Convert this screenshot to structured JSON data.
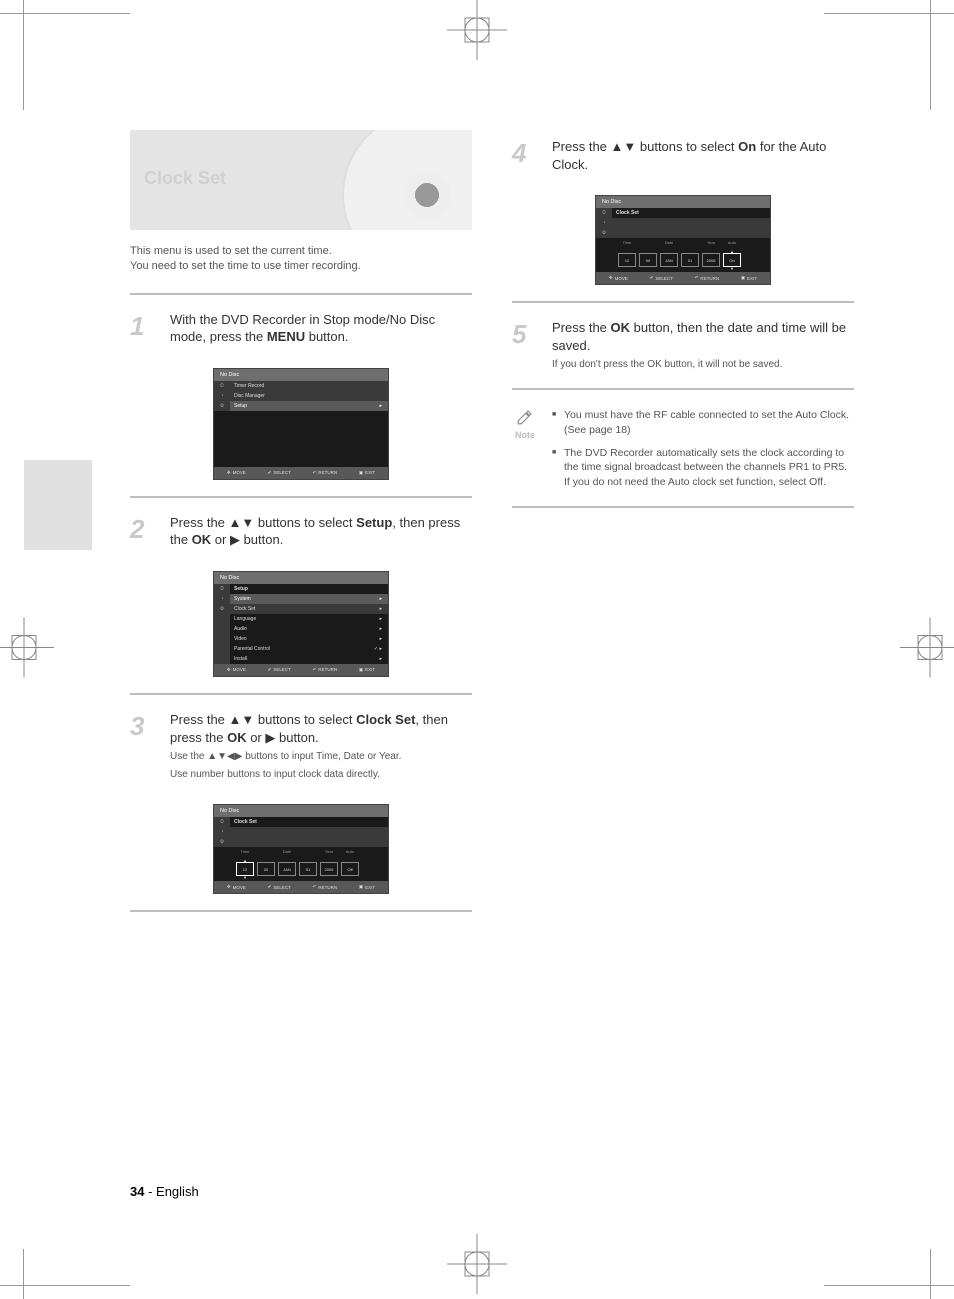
{
  "page": {
    "number": "34",
    "lang_label": "- English"
  },
  "header": {
    "title": "Clock Set"
  },
  "intro": {
    "line1": "This menu is used to set the current time.",
    "line2": "You need to set the time to use timer recording."
  },
  "steps": {
    "s1": {
      "num": "1",
      "pre": "With the DVD Recorder in Stop mode/No Disc mode, press the ",
      "bold": "MENU",
      "post": " button."
    },
    "s2": {
      "num": "2",
      "pre": "Press the ▲▼ buttons to select ",
      "bold": "Setup",
      "mid": ", then press the ",
      "bold2": "OK",
      "post": " or ▶ button."
    },
    "s3": {
      "num": "3",
      "pre": "Press the ▲▼ buttons to select ",
      "bold": "Clock Set",
      "mid": ", then press the ",
      "bold2": "OK",
      "post": " or ▶ button.",
      "sub1": "Use the ▲▼◀▶ buttons to input Time, Date or Year.",
      "sub2": "Use number buttons to input clock data directly."
    },
    "s4": {
      "num": "4",
      "pre": "Press the ▲▼ buttons to select ",
      "bold": "On",
      "post": " for the Auto Clock."
    },
    "s5": {
      "num": "5",
      "pre": "Press the ",
      "bold": "OK",
      "post": " button, then the date and time will be saved.",
      "sub": "If you don't press the OK button, it will not be saved."
    }
  },
  "notes": {
    "label": "Note",
    "item1": "You must have the RF cable connected to set the Auto Clock. (See page 18)",
    "item2": "The DVD Recorder automatically sets the clock according to the time signal broadcast between the channels PR1 to PR5. If you do not need the Auto clock set function, select Off."
  },
  "screens": {
    "common_footer": {
      "move": "MOVE",
      "select": "SELECT",
      "return": "RETURN",
      "exit": "EXIT"
    },
    "screen1": {
      "title": "No Disc",
      "items": [
        "Timer Record",
        "Disc Manager",
        "Setup"
      ],
      "hl_index": 2
    },
    "screen2": {
      "title": "No Disc",
      "heading": "Setup",
      "items": [
        {
          "label": "System",
          "val": ""
        },
        {
          "label": "Clock Set",
          "val": ""
        },
        {
          "label": "Language",
          "val": ""
        },
        {
          "label": "Audio",
          "val": ""
        },
        {
          "label": "Video",
          "val": ""
        },
        {
          "label": "Parental Control",
          "val": ""
        },
        {
          "label": "Install",
          "val": ""
        }
      ],
      "hl_index": 1
    },
    "screen3": {
      "title": "No Disc",
      "heading": "Clock Set",
      "labels": [
        "Time",
        "Date",
        "Year",
        "Auto"
      ],
      "vals": [
        "12",
        "00",
        "JAN",
        "01",
        "2005",
        "Off"
      ],
      "active": 0
    },
    "screen4": {
      "title": "No Disc",
      "heading": "Clock Set",
      "labels": [
        "Time",
        "Date",
        "Year",
        "Auto"
      ],
      "vals": [
        "12",
        "00",
        "JAN",
        "01",
        "2005",
        "On"
      ],
      "active": 5
    }
  }
}
